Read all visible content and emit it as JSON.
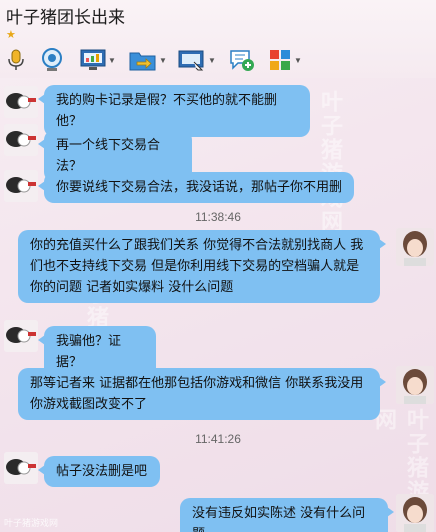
{
  "window": {
    "title": "叶子猪团长出来",
    "level_icon": "star-icon"
  },
  "toolbar": {
    "items": [
      {
        "name": "voice-call",
        "icon": "microphone-icon",
        "has_menu": false
      },
      {
        "name": "video-call",
        "icon": "webcam-icon",
        "has_menu": false
      },
      {
        "name": "app",
        "icon": "monitor-chart-icon",
        "has_menu": true
      },
      {
        "name": "file-transfer",
        "icon": "folder-arrow-icon",
        "has_menu": true
      },
      {
        "name": "remote-desktop",
        "icon": "screen-share-icon",
        "has_menu": true
      },
      {
        "name": "create-group",
        "icon": "chat-add-icon",
        "has_menu": false
      },
      {
        "name": "apps",
        "icon": "app-grid-icon",
        "has_menu": true
      }
    ]
  },
  "messages": [
    {
      "side": "left",
      "text": "我的购卡记录是假？不买他的就不能删他？"
    },
    {
      "side": "left",
      "text": "再一个线下交易合法？"
    },
    {
      "side": "left",
      "text": "你要说线下交易合法，我没话说，那帖子你不用删"
    },
    {
      "time": "11:38:46"
    },
    {
      "side": "right",
      "text": "你的充值买什么了跟我们关系 你觉得不合法就别找商人 我们也不支持线下交易 但是你利用线下交易的空档骗人就是你的问题 记者如实爆料 没什么问题"
    },
    {
      "side": "left",
      "text": "我骗他？证据？"
    },
    {
      "side": "right",
      "text": "那等记者来 证据都在他那包括你游戏和微信 你联系我没用 你游戏截图改变不了"
    },
    {
      "time": "11:41:26"
    },
    {
      "side": "left",
      "text": "帖子没法删是吧"
    },
    {
      "side": "right",
      "text": "没有违反如实陈述 没有什么问题"
    }
  ],
  "watermark": "叶子猪游戏网",
  "footer_logo": "叶子猪游戏网",
  "colors": {
    "bubble": "#7fc0f2",
    "accent_star": "#e8a717"
  }
}
